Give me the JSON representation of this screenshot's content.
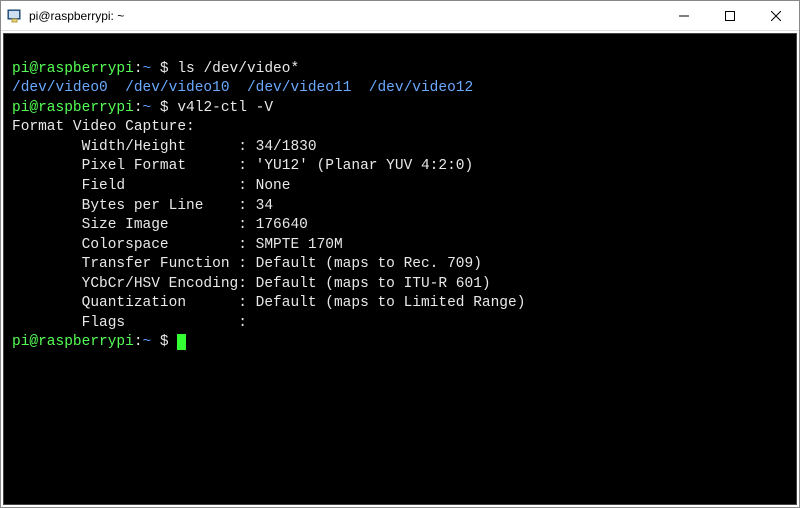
{
  "window": {
    "title": "pi@raspberrypi: ~"
  },
  "terminal": {
    "prompt_userhost": "pi@raspberrypi",
    "prompt_sep": ":",
    "prompt_path": "~",
    "prompt_end": " $ ",
    "cmd1": "ls /dev/video*",
    "ls_output": "/dev/video0  /dev/video10  /dev/video11  /dev/video12",
    "cmd2": "v4l2-ctl -V",
    "format_header": "Format Video Capture:",
    "fields": {
      "width_height": {
        "label": "        Width/Height      ",
        "sep": ": ",
        "value": "34/1830"
      },
      "pixel_format": {
        "label": "        Pixel Format      ",
        "sep": ": ",
        "value": "'YU12' (Planar YUV 4:2:0)"
      },
      "field": {
        "label": "        Field             ",
        "sep": ": ",
        "value": "None"
      },
      "bytes_per_line": {
        "label": "        Bytes per Line    ",
        "sep": ": ",
        "value": "34"
      },
      "size_image": {
        "label": "        Size Image        ",
        "sep": ": ",
        "value": "176640"
      },
      "colorspace": {
        "label": "        Colorspace        ",
        "sep": ": ",
        "value": "SMPTE 170M"
      },
      "transfer_function": {
        "label": "        Transfer Function ",
        "sep": ": ",
        "value": "Default (maps to Rec. 709)"
      },
      "ycbcr_encoding": {
        "label": "        YCbCr/HSV Encoding",
        "sep": ": ",
        "value": "Default (maps to ITU-R 601)"
      },
      "quantization": {
        "label": "        Quantization      ",
        "sep": ": ",
        "value": "Default (maps to Limited Range)"
      },
      "flags": {
        "label": "        Flags             ",
        "sep": ": ",
        "value": ""
      }
    }
  }
}
